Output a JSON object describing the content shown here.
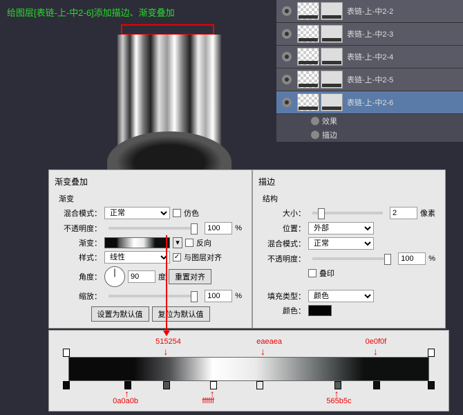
{
  "title": "给图层[表链-上-中2-6]添加描边、渐变叠加",
  "layers": {
    "items": [
      {
        "name": "表链-上-中2-2",
        "sel": false
      },
      {
        "name": "表链-上-中2-3",
        "sel": false
      },
      {
        "name": "表链-上-中2-4",
        "sel": false
      },
      {
        "name": "表链-上-中2-5",
        "sel": false
      },
      {
        "name": "表链-上-中2-6",
        "sel": true
      }
    ],
    "fx": {
      "label": "效果",
      "stroke": "描边"
    }
  },
  "grad_overlay": {
    "title": "渐变叠加",
    "group": "渐变",
    "blend_label": "混合模式：",
    "blend_value": "正常",
    "dither": "仿色",
    "opacity_label": "不透明度：",
    "opacity_value": "100",
    "pct": "%",
    "gradient_label": "渐变：",
    "reverse": "反向",
    "style_label": "样式：",
    "style_value": "线性",
    "align": "与图层对齐",
    "angle_label": "角度：",
    "angle_value": "90",
    "angle_unit": "度",
    "reset": "重置对齐",
    "scale_label": "缩放：",
    "scale_value": "100",
    "btn_default": "设置为默认值",
    "btn_reset": "复位为默认值"
  },
  "stroke": {
    "title": "描边",
    "group": "结构",
    "size_label": "大小：",
    "size_value": "2",
    "size_unit": "像素",
    "pos_label": "位置：",
    "pos_value": "外部",
    "blend_label": "混合模式：",
    "blend_value": "正常",
    "opacity_label": "不透明度：",
    "opacity_value": "100",
    "pct": "%",
    "overprint": "叠印",
    "filltype_label": "填充类型：",
    "filltype_value": "颜色",
    "color_label": "颜色：",
    "color": "#040404"
  },
  "gradient_stops": {
    "upper": [
      {
        "pos": 28,
        "color": "515254"
      },
      {
        "pos": 52,
        "color": "eaeaea"
      },
      {
        "pos": 82,
        "color": "0e0f0f"
      }
    ],
    "lower": [
      {
        "pos": 18,
        "color": "0a0a0b"
      },
      {
        "pos": 40,
        "color": "ffffff"
      },
      {
        "pos": 72,
        "color": "565b5c"
      }
    ]
  }
}
